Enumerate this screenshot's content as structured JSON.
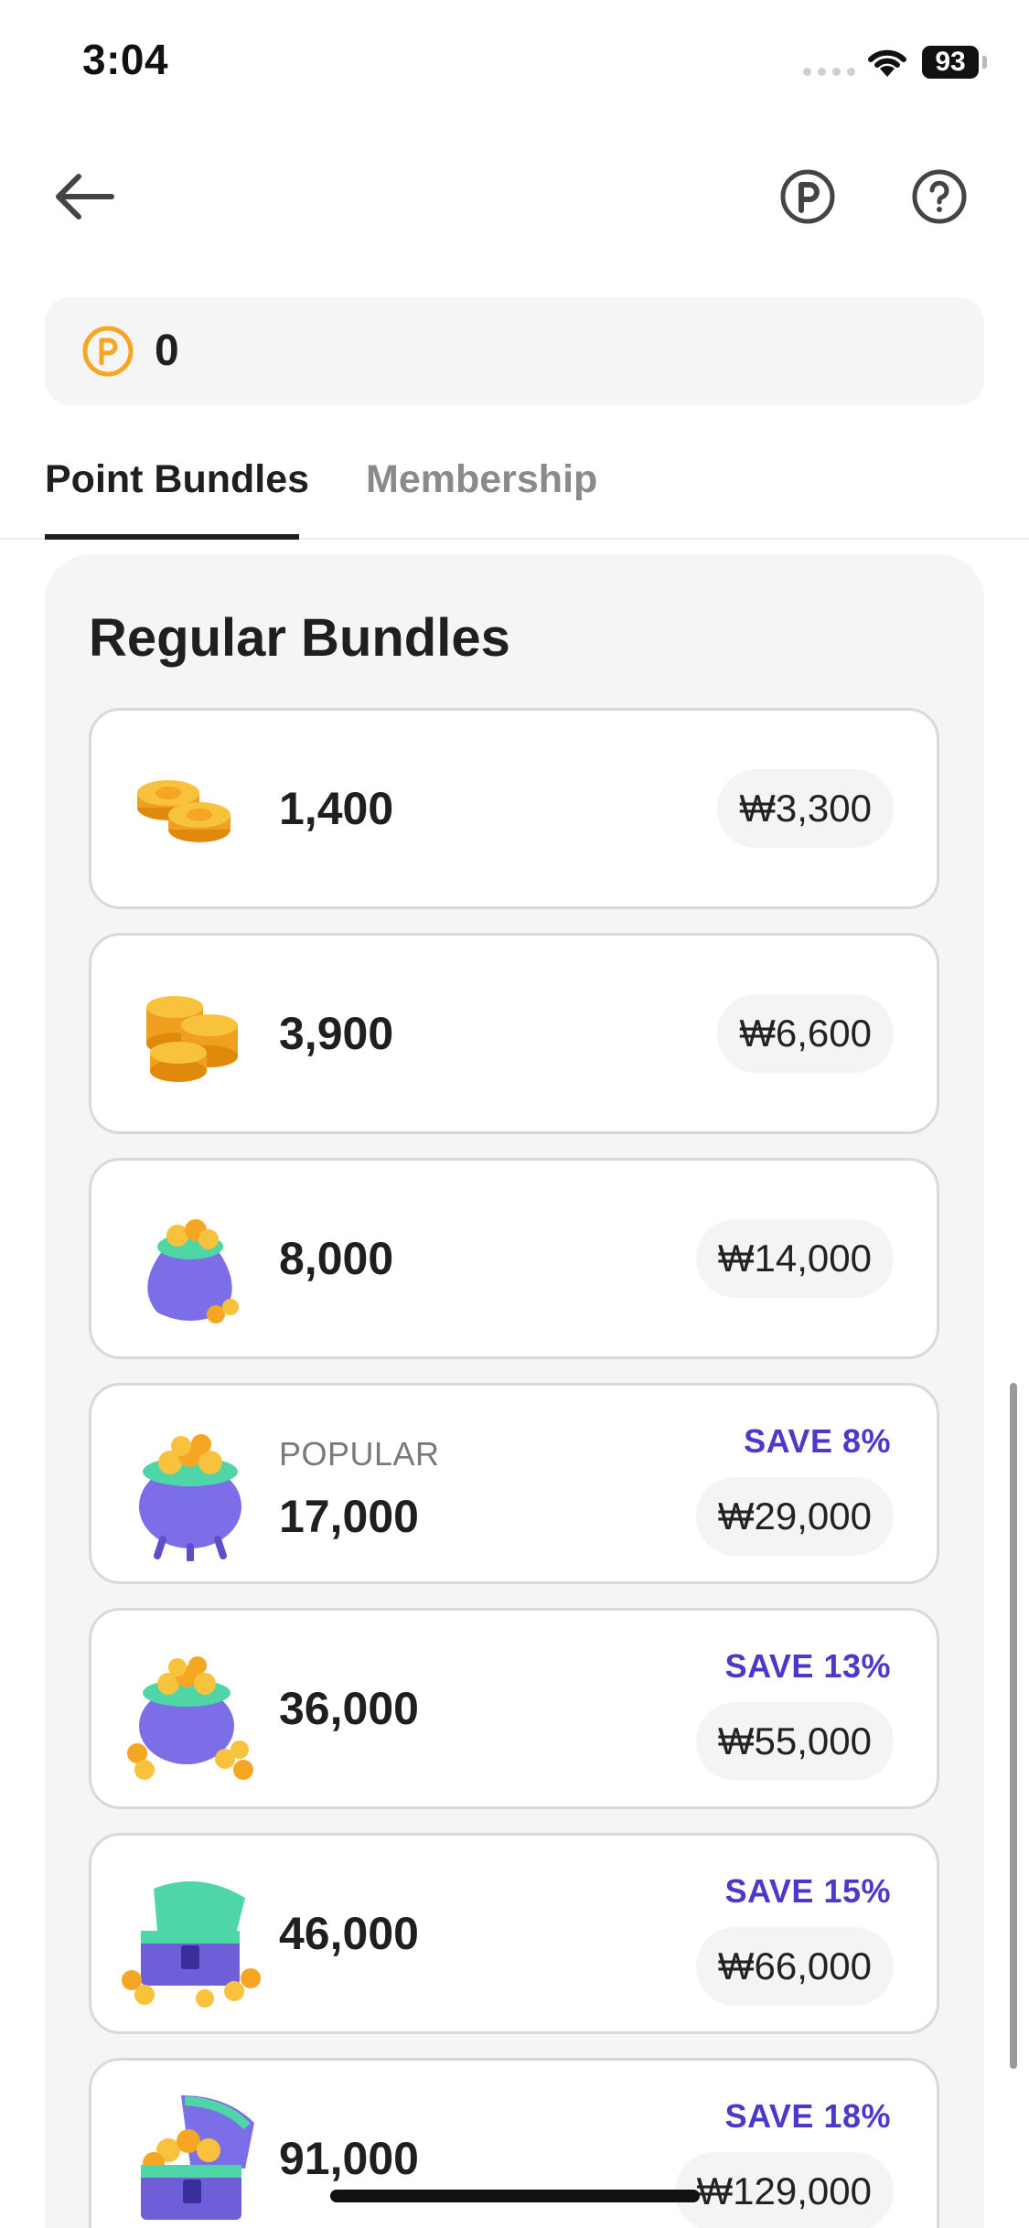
{
  "status_bar": {
    "time": "3:04",
    "battery": "93"
  },
  "header": {
    "back_icon": "arrow-left-icon",
    "points_icon": "points-p-icon",
    "help_icon": "question-circle-icon"
  },
  "balance": {
    "icon": "point-coin-icon",
    "value": "0"
  },
  "tabs": [
    {
      "label": "Point Bundles",
      "active": true
    },
    {
      "label": "Membership",
      "active": false
    }
  ],
  "section": {
    "title": "Regular Bundles",
    "bundles": [
      {
        "icon": "coin-stack-small-icon",
        "amount": "1,400",
        "price": "₩3,300"
      },
      {
        "icon": "coin-stack-medium-icon",
        "amount": "3,900",
        "price": "₩6,600"
      },
      {
        "icon": "coin-pouch-icon",
        "amount": "8,000",
        "price": "₩14,000"
      },
      {
        "icon": "coin-cauldron-icon",
        "tag": "POPULAR",
        "amount": "17,000",
        "save": "SAVE 8%",
        "price": "₩29,000"
      },
      {
        "icon": "coin-cauldron-overflow-icon",
        "amount": "36,000",
        "save": "SAVE 13%",
        "price": "₩55,000"
      },
      {
        "icon": "treasure-chest-icon",
        "amount": "46,000",
        "save": "SAVE 15%",
        "price": "₩66,000"
      },
      {
        "icon": "treasure-chest-large-icon",
        "amount": "91,000",
        "save": "SAVE 18%",
        "price": "₩129,000"
      }
    ]
  },
  "colors": {
    "accent_save": "#4b39c9",
    "coin": "#f5a623",
    "pot": "#7b6ee6",
    "chest": "#4fd6a6"
  }
}
